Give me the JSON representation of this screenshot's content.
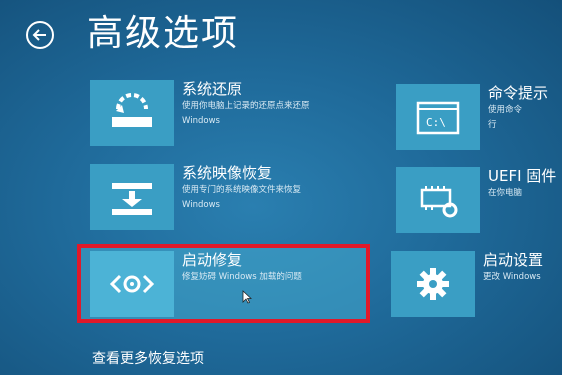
{
  "header": {
    "title": "高级选项"
  },
  "options": [
    {
      "title": "系统还原",
      "desc1": "使用你电脑上记录的还原点来还原",
      "desc2": "Windows",
      "icon": "system-restore-icon"
    },
    {
      "title": "系统映像恢复",
      "desc1": "使用专门的系统映像文件来恢复",
      "desc2": "Windows",
      "icon": "system-image-recovery-icon"
    },
    {
      "title": "启动修复",
      "desc1": "修复妨碍 Windows 加载的问题",
      "desc2": "",
      "icon": "startup-repair-icon"
    },
    {
      "title": "命令提示",
      "desc1": "使用命令",
      "desc2": "行",
      "icon": "command-prompt-icon"
    },
    {
      "title": "UEFI 固件",
      "desc1": "在你电脑",
      "desc2": "",
      "icon": "uefi-firmware-icon"
    },
    {
      "title": "启动设置",
      "desc1": "更改 Windows",
      "desc2": "",
      "icon": "startup-settings-icon"
    }
  ],
  "command_prompt_icon_text": "C:\\",
  "footer": {
    "more_link": "查看更多恢复选项"
  },
  "colors": {
    "background": "#1f6a9a",
    "tile": "#3a9ec4",
    "highlight_border": "#e0192a"
  }
}
